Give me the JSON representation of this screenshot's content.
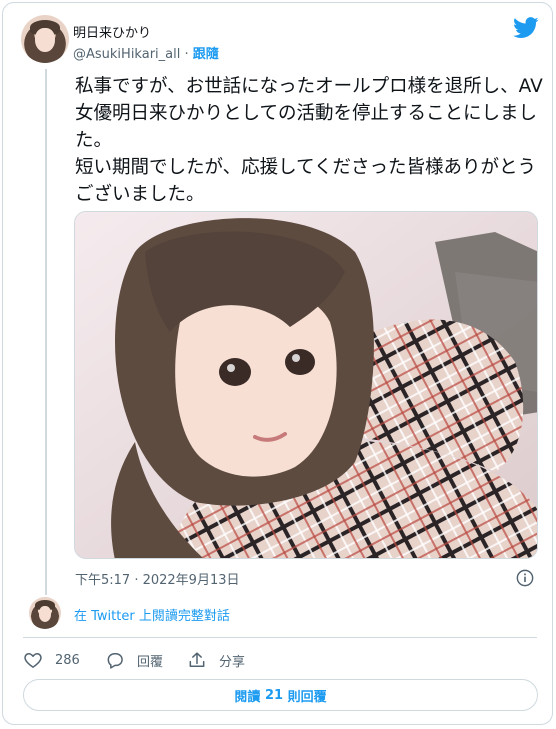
{
  "author": {
    "name": "明日来ひかり",
    "handle": "@AsukiHikari_all",
    "separator": "·",
    "follow_label": "跟隨"
  },
  "tweet": {
    "paragraphs": [
      "私事ですが、お世話になったオールプロ様を退所し、AV女優明日来ひかりとしての活動を停止することにしました。",
      "短い期間でしたが、応援してくださった皆様ありがとうございました。"
    ],
    "timestamp": "下午5:17 · 2022年9月13日"
  },
  "thread": {
    "view_label": "在 Twitter 上閱讀完整對話"
  },
  "actions": {
    "like_count": "286",
    "reply_label": "回覆",
    "share_label": "分享"
  },
  "read_replies": {
    "prefix": "閱讀 ",
    "count": "21",
    "suffix": " 則回覆"
  },
  "colors": {
    "accent": "#1d9bf0",
    "secondary_text": "#536471",
    "border": "#cfd9de"
  },
  "icons": {
    "brand": "twitter-bird-icon",
    "info": "info-icon",
    "like": "heart-icon",
    "reply": "reply-bubble-icon",
    "share": "share-icon"
  }
}
